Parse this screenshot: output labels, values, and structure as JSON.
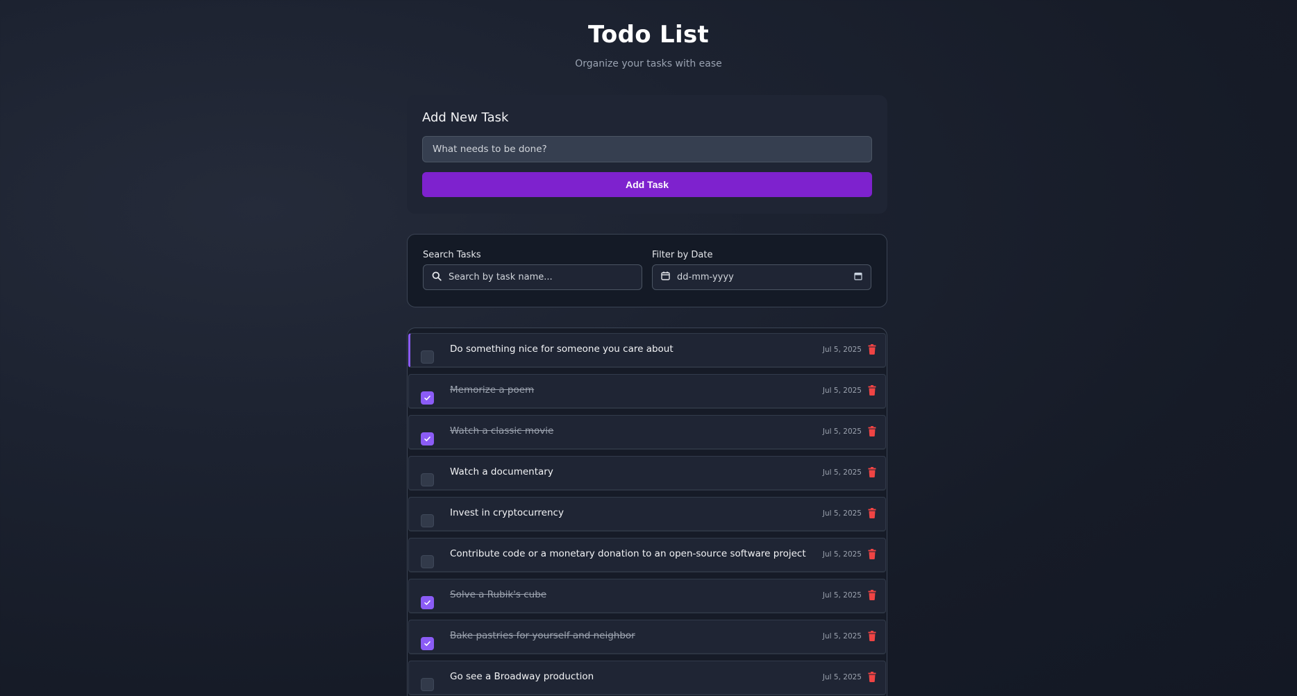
{
  "header": {
    "title": "Todo List",
    "subtitle": "Organize your tasks with ease"
  },
  "add_task": {
    "heading": "Add New Task",
    "input_placeholder": "What needs to be done?",
    "button_label": "Add Task"
  },
  "filters": {
    "search_label": "Search Tasks",
    "search_placeholder": "Search by task name...",
    "date_label": "Filter by Date",
    "date_placeholder": "dd-mm-yyyy"
  },
  "icons": {
    "search": "search-icon",
    "calendar": "calendar-icon",
    "calendar_picker": "calendar-picker-icon",
    "check": "check-icon",
    "delete": "trash-icon"
  },
  "colors": {
    "accent": "#7e22ce",
    "checkbox_checked": "#8b5cf6",
    "delete": "#ef4444"
  },
  "tasks": [
    {
      "text": "Do something nice for someone you care about",
      "date": "Jul 5, 2025",
      "done": false,
      "active": true
    },
    {
      "text": "Memorize a poem",
      "date": "Jul 5, 2025",
      "done": true,
      "active": false
    },
    {
      "text": "Watch a classic movie",
      "date": "Jul 5, 2025",
      "done": true,
      "active": false
    },
    {
      "text": "Watch a documentary",
      "date": "Jul 5, 2025",
      "done": false,
      "active": false
    },
    {
      "text": "Invest in cryptocurrency",
      "date": "Jul 5, 2025",
      "done": false,
      "active": false
    },
    {
      "text": "Contribute code or a monetary donation to an open-source software project",
      "date": "Jul 5, 2025",
      "done": false,
      "active": false
    },
    {
      "text": "Solve a Rubik's cube",
      "date": "Jul 5, 2025",
      "done": true,
      "active": false
    },
    {
      "text": "Bake pastries for yourself and neighbor",
      "date": "Jul 5, 2025",
      "done": true,
      "active": false
    },
    {
      "text": "Go see a Broadway production",
      "date": "Jul 5, 2025",
      "done": false,
      "active": false
    }
  ]
}
